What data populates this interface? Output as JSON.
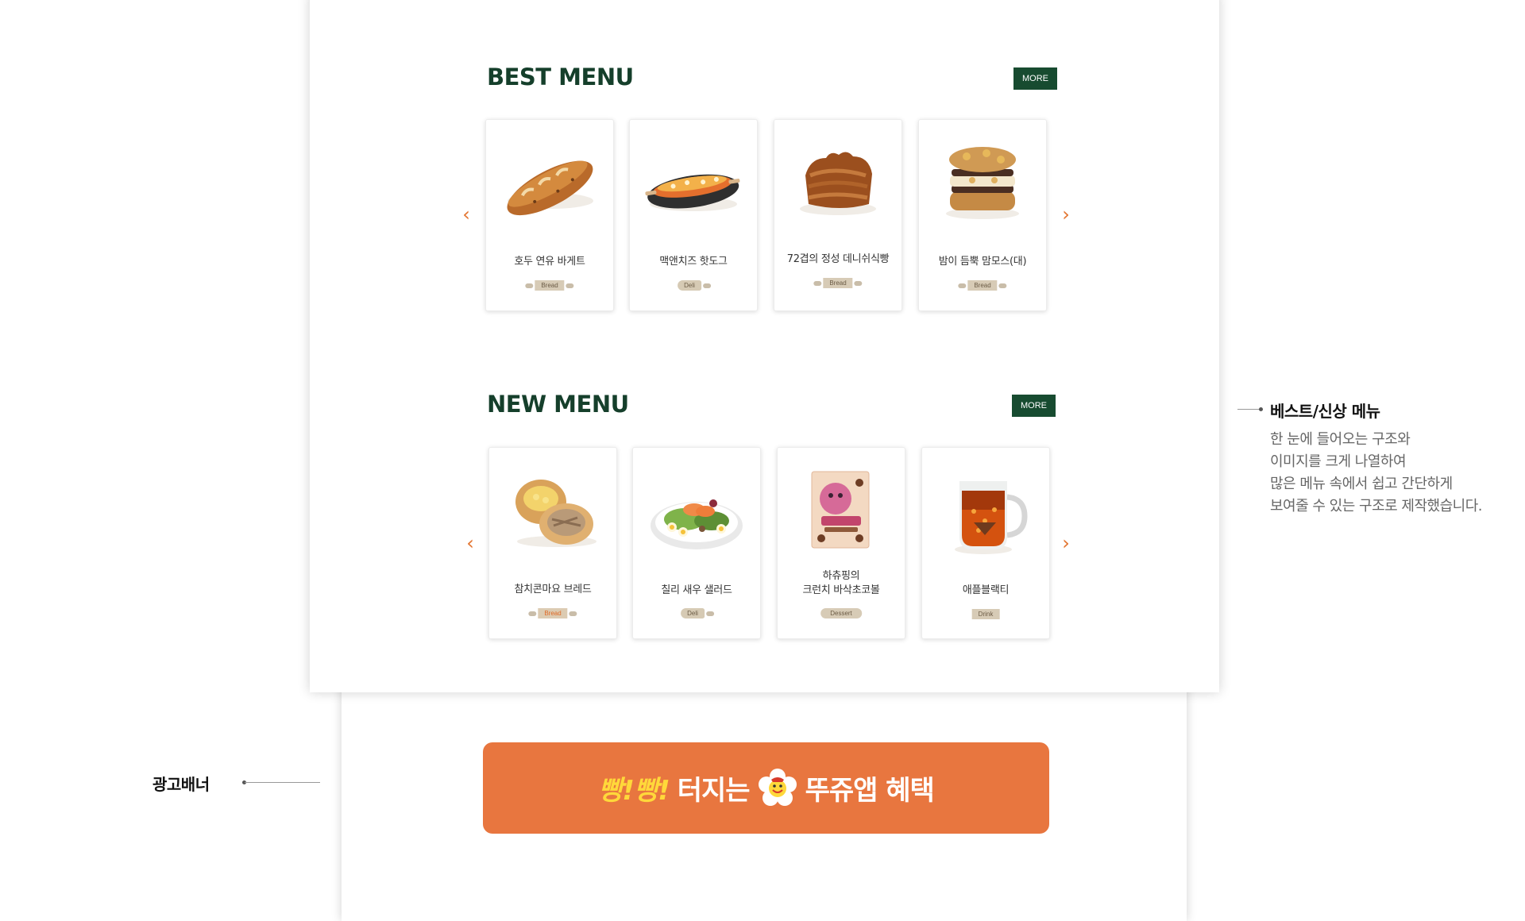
{
  "best_menu": {
    "title": "BEST MENU",
    "more_label": "MORE",
    "items": [
      {
        "name": "호두 연유 바게트",
        "tag": "Bread"
      },
      {
        "name": "맥앤치즈 핫도그",
        "tag": "Deli"
      },
      {
        "name": "72겹의 정성 데니쉬식빵",
        "tag": "Bread"
      },
      {
        "name": "밤이 듬뿍 맘모스(대)",
        "tag": "Bread"
      }
    ]
  },
  "new_menu": {
    "title": "NEW MENU",
    "more_label": "MORE",
    "items": [
      {
        "name": "참치콘마요 브레드",
        "tag": "Bread"
      },
      {
        "name": "칠리 새우 샐러드",
        "tag": "Deli"
      },
      {
        "name": "하츄핑의\n크런치 바삭초코볼",
        "tag": "Dessert"
      },
      {
        "name": "애플블랙티",
        "tag": "Drink"
      }
    ]
  },
  "carousel": {
    "prev_icon": "chevron-left-icon",
    "next_icon": "chevron-right-icon",
    "prev_glyph": "‹",
    "next_glyph": "›"
  },
  "ad_banner": {
    "text_yellow": "빵!빵!",
    "text_white_1": "터지는",
    "icon": "smiley-flower-icon",
    "text_white_2": "뚜쥬앱 혜택"
  },
  "annotations": {
    "menu": {
      "title": "베스트/신상 메뉴",
      "description": "한 눈에 들어오는 구조와\n이미지를 크게 나열하여\n많은 메뉴 속에서 쉽고 간단하게\n보여줄 수 있는 구조로 제작했습니다."
    },
    "banner": {
      "title": "광고배너"
    }
  },
  "colors": {
    "brand_green": "#174b30",
    "title_green": "#153f2b",
    "accent_orange": "#e3742f",
    "banner_orange": "#e8763f",
    "banner_yellow": "#ffd83a"
  }
}
